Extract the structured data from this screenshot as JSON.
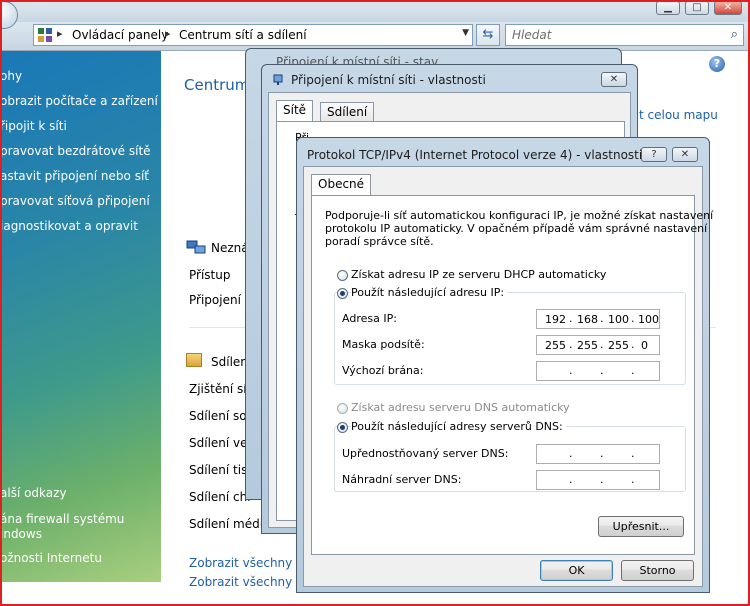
{
  "breadcrumb": [
    "Ovládací panely",
    "Centrum sítí a sdílení"
  ],
  "search": {
    "placeholder": "Hledat"
  },
  "sidebar": {
    "items": [
      "ohy",
      "obrazit počítače a zařízení",
      "řipojit k síti",
      "pravovat bezdrátové sítě",
      "astavit připojení nebo síť",
      "pravovat síťová připojení",
      "iagnostikovat a opravit"
    ],
    "bottom_title": "alší odkazy",
    "links": [
      "ána firewall systému",
      "indows",
      "ožnosti Internetu"
    ]
  },
  "main": {
    "title": "Centrum",
    "map_link": "t celou mapu",
    "network_name": "Nezná",
    "rows_network": [
      "Přístup",
      "Připojení"
    ],
    "sharing_title": "Sdílen",
    "rows_sharing": [
      "Zjištění síte",
      "Sdílení sou",
      "Sdílení veř",
      "Sdílení tisk",
      "Sdílení chr",
      "Sdílení médií"
    ],
    "link1": "Zobrazit všechny so",
    "link2": "Zobrazit všechny sdí"
  },
  "dialog_back": {
    "title": "Připojení k místní síti - stav"
  },
  "dialog_mid": {
    "title": "Připojení k místní síti - vlastnosti",
    "tabs": [
      "Sítě",
      "Sdílení"
    ],
    "partial1": "Při",
    "partial2": "T"
  },
  "dialog_tcp": {
    "title": "Protokol TCP/IPv4 (Internet Protocol verze 4) - vlastnosti",
    "help_label": "?",
    "tab": "Obecné",
    "description": [
      "Podporuje-li síť automatickou konfiguraci IP, je možné získat nastavení",
      "protokolu IP automaticky. V opačném případě vám správné nastavení",
      "poradí správce sítě."
    ],
    "radio_ip_auto": "Získat adresu IP ze serveru DHCP automaticky",
    "radio_ip_manual": "Použít následující adresu IP:",
    "ip_label": "Adresa IP:",
    "ip_value": [
      "192",
      "168",
      "100",
      "100"
    ],
    "mask_label": "Maska podsítě:",
    "mask_value": [
      "255",
      "255",
      "255",
      "0"
    ],
    "gateway_label": "Výchozí brána:",
    "radio_dns_auto": "Získat adresu serveru DNS automaticky",
    "radio_dns_manual": "Použít následující adresy serverů DNS:",
    "dns_pref_label": "Upřednostňovaný server DNS:",
    "dns_alt_label": "Náhradní server DNS:",
    "advanced_button": "Upřesnit...",
    "ok_button": "OK",
    "cancel_button": "Storno"
  }
}
